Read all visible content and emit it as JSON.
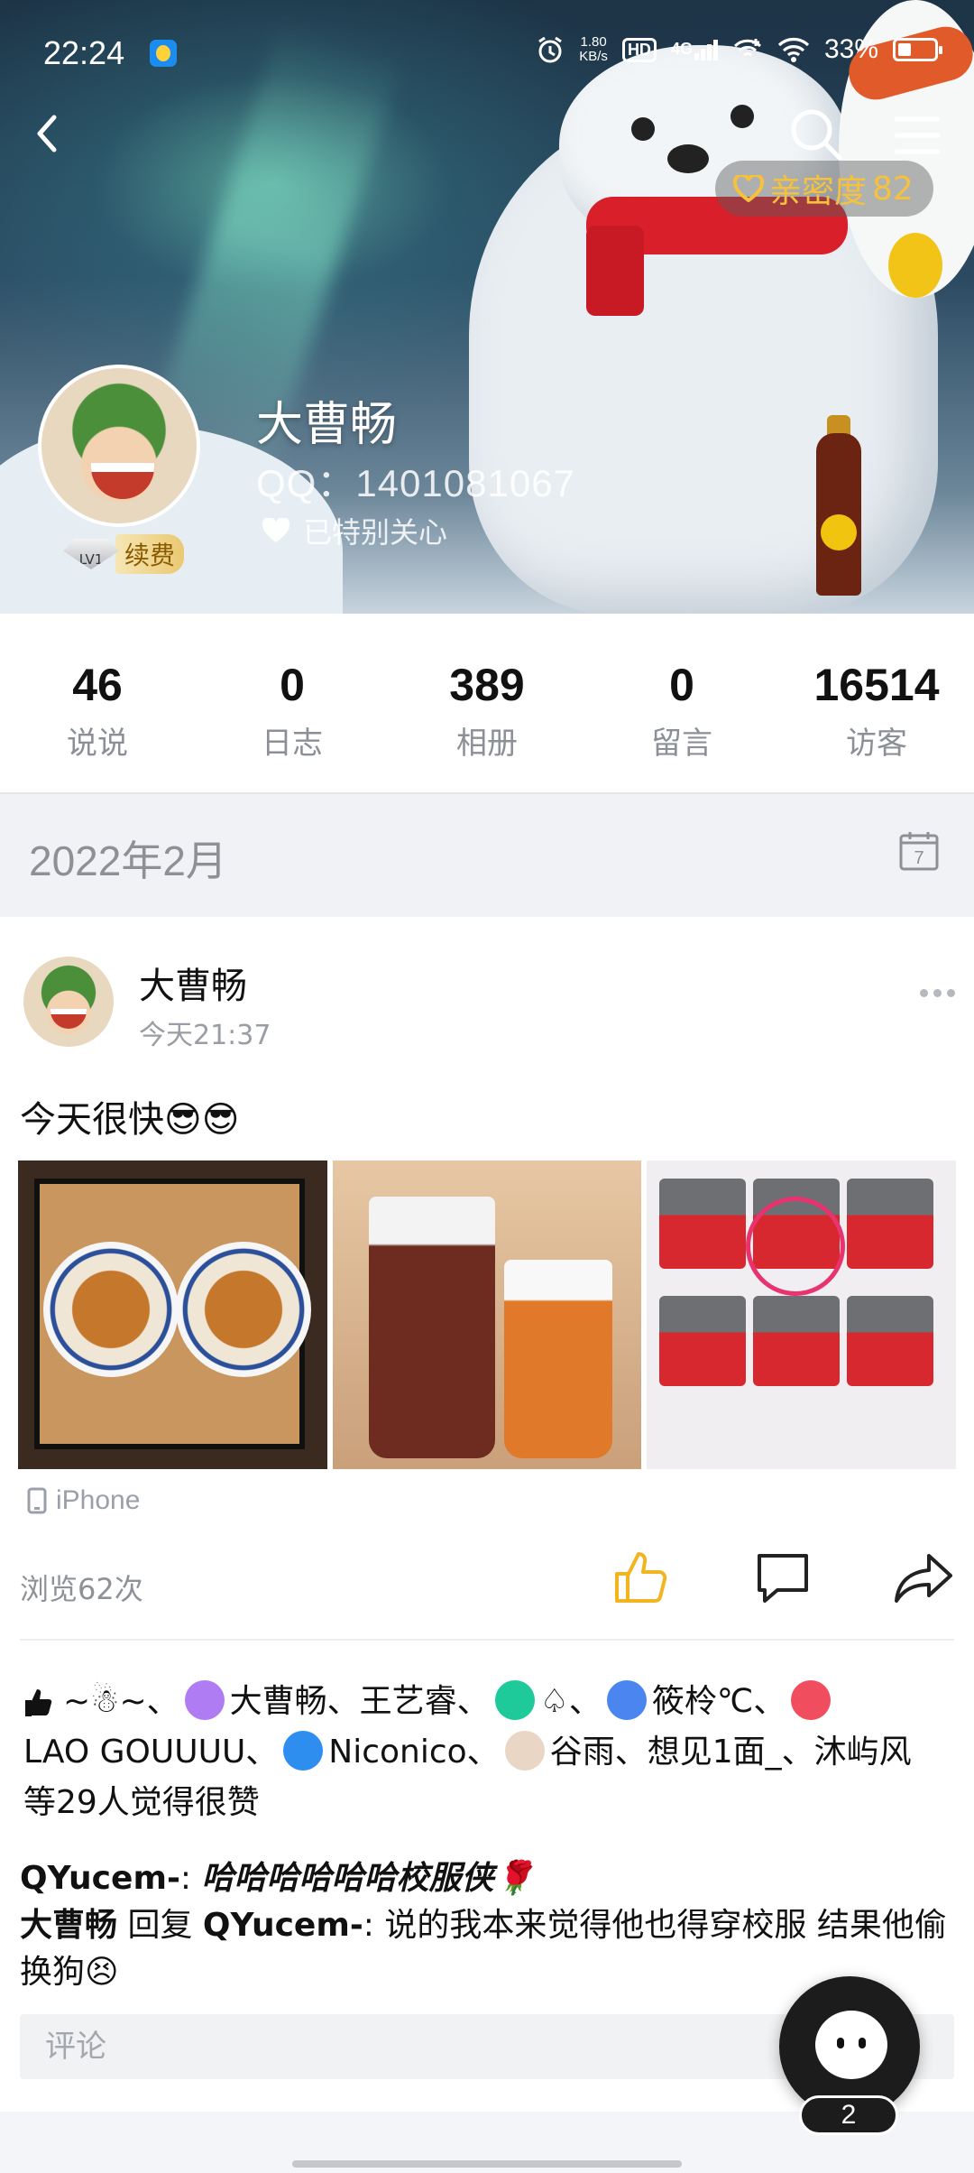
{
  "status_bar": {
    "time": "22:24",
    "net_speed_value": "1.80",
    "net_speed_unit": "KB/s",
    "hd": "HD",
    "network": "4G",
    "battery": "33%"
  },
  "profile": {
    "intimacy_label": "亲密度",
    "intimacy_value": "82",
    "name": "大曹畅",
    "qq": "QQ：1401081067",
    "special_care": "已特别关心",
    "level": "LV1",
    "renew": "续费"
  },
  "stats": [
    {
      "value": "46",
      "label": "说说"
    },
    {
      "value": "0",
      "label": "日志"
    },
    {
      "value": "389",
      "label": "相册"
    },
    {
      "value": "0",
      "label": "留言"
    },
    {
      "value": "16514",
      "label": "访客"
    }
  ],
  "month": "2022年2月",
  "calendar_day": "7",
  "post": {
    "author": "大曹畅",
    "time": "今天21:37",
    "text": "今天很快😎😎",
    "device": "iPhone",
    "views": "浏览62次",
    "likes_line1": "~☃~、",
    "likes_names_a": "大曹畅、王艺睿、",
    "likes_spade": "♤、",
    "likes_names_b": "筱柃℃、",
    "likes_line2_a": "LAO GOUUUU、",
    "likes_line2_b": "Niconico、",
    "likes_line2_c": "谷雨、想见1面_、沐屿风",
    "likes_line3": "等29人觉得很赞",
    "comments": [
      {
        "author": "QYucem-",
        "sep": ": ",
        "text": "哈哈哈哈哈哈校服侠🌹"
      },
      {
        "author": "大曹畅",
        "reply_word": " 回复 ",
        "reply_to": "QYucem-",
        "sep": ": ",
        "text": "说的我本来觉得他也得穿校服 结果他偷换狗😣"
      }
    ],
    "comment_placeholder": "评论"
  },
  "floating_pet": {
    "count": "2"
  },
  "colors": {
    "accent": "#f6c23b",
    "like": "#f2b51f",
    "muted": "#8b8f96"
  }
}
